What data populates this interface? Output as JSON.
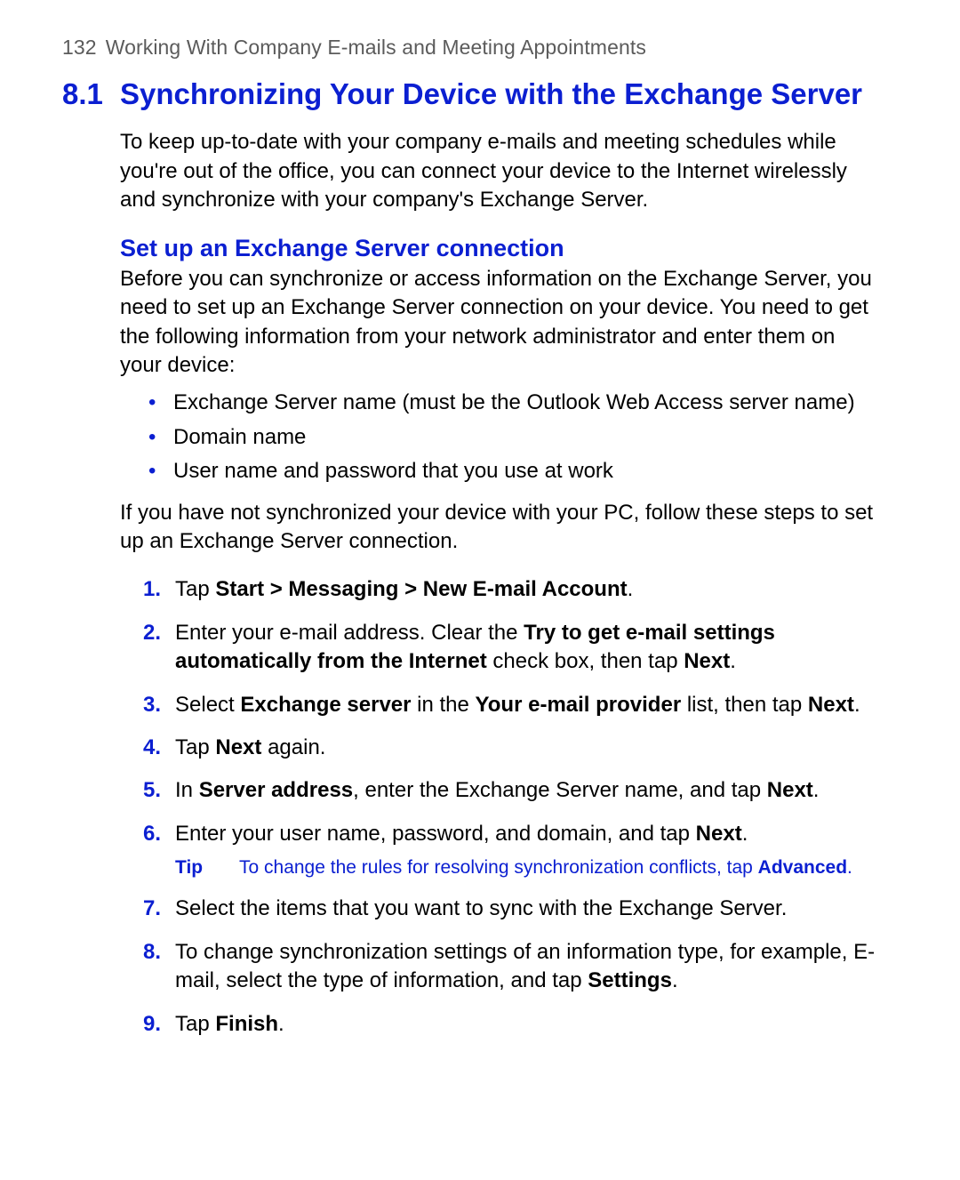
{
  "header": {
    "page_number": "132",
    "chapter_title": "Working With Company E-mails and Meeting Appointments"
  },
  "section": {
    "number": "8.1",
    "title": "Synchronizing Your Device with the Exchange Server",
    "intro": "To keep up-to-date with your company e-mails and meeting schedules while you're out of the office, you can connect your device to the Internet wirelessly and synchronize with your company's Exchange Server."
  },
  "sub": {
    "heading": "Set up an Exchange Server connection",
    "para1": "Before you can synchronize or access information on the Exchange Server, you need to set up an Exchange Server connection on your device. You need to get the following information from your network administrator and enter them on your device:",
    "bullets": [
      "Exchange Server name (must be the Outlook Web Access server name)",
      "Domain name",
      "User name and password that you use at work"
    ],
    "para2": "If you have not synchronized your device with your PC, follow these steps to set up an Exchange Server connection."
  },
  "steps": {
    "s1_pre": "Tap ",
    "s1_bold": "Start > Messaging > New E-mail Account",
    "s1_post": ".",
    "s2_pre": "Enter your e-mail address. Clear the ",
    "s2_bold1": "Try to get e-mail settings automatically from the Internet",
    "s2_mid": " check box, then tap ",
    "s2_bold2": "Next",
    "s2_post": ".",
    "s3_pre": "Select ",
    "s3_bold1": "Exchange server",
    "s3_mid1": " in the ",
    "s3_bold2": "Your e-mail provider",
    "s3_mid2": " list, then tap ",
    "s3_bold3": "Next",
    "s3_post": ".",
    "s4_pre": "Tap ",
    "s4_bold": "Next",
    "s4_post": " again.",
    "s5_pre": "In ",
    "s5_bold1": "Server address",
    "s5_mid": ", enter the Exchange Server name, and tap ",
    "s5_bold2": "Next",
    "s5_post": ".",
    "s6_pre": "Enter your user name, password, and domain, and tap ",
    "s6_bold": "Next",
    "s6_post": ".",
    "tip_label": "Tip",
    "tip_pre": "To change the rules for resolving synchronization conflicts, tap ",
    "tip_bold": "Advanced",
    "tip_post": ".",
    "s7": "Select the items that you want to sync with the Exchange Server.",
    "s8_pre": "To change synchronization settings of an information type, for example, E-mail, select the type of information, and tap ",
    "s8_bold": "Settings",
    "s8_post": ".",
    "s9_pre": "Tap ",
    "s9_bold": "Finish",
    "s9_post": "."
  }
}
